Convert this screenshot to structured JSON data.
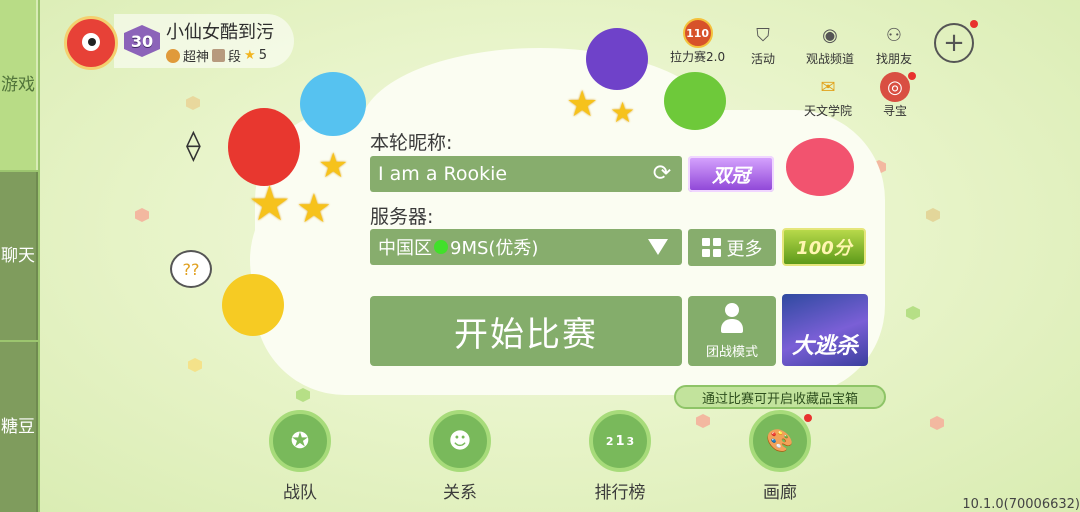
{
  "side_tabs": [
    {
      "label": "游戏",
      "active": true
    },
    {
      "label": "聊天",
      "active": false
    },
    {
      "label": "糖豆",
      "active": false
    }
  ],
  "player": {
    "level": "30",
    "name": "小仙女酷到污",
    "rank_title": "超神",
    "rank_suffix": "段",
    "rank_stars": "5"
  },
  "top_icons": [
    {
      "icon": "rally-110-badge",
      "badge_text": "110",
      "label": "拉力赛2.0"
    },
    {
      "icon": "activity-shield-icon",
      "label": "活动"
    },
    {
      "icon": "eye-icon",
      "label": "观战频道"
    },
    {
      "icon": "add-friend-icon",
      "label": "找朋友"
    },
    {
      "icon": "plus-icon",
      "label": "+"
    }
  ],
  "side_icons": [
    {
      "icon": "academy-icon",
      "label": "天文学院"
    },
    {
      "icon": "treasure-icon",
      "label": "寻宝"
    }
  ],
  "form": {
    "nickname_label": "本轮昵称:",
    "nickname_value": "I am a Rookie",
    "server_label": "服务器:",
    "server_region": "中国区",
    "server_latency": "9MS(优秀)",
    "more_label": "更多",
    "crown_badge": "双冠",
    "score_badge": "100分"
  },
  "actions": {
    "start_label": "开始比赛",
    "team_mode_label": "团战模式",
    "escape_label": "大逃杀",
    "tooltip": "通过比赛可开启收藏品宝箱"
  },
  "bottom_nav": [
    {
      "icon": "team-crest-icon",
      "label": "战队"
    },
    {
      "icon": "people-icon",
      "label": "关系"
    },
    {
      "icon": "podium-icon",
      "label": "排行榜",
      "podium": [
        "2",
        "1",
        "3"
      ]
    },
    {
      "icon": "palette-icon",
      "label": "画廊"
    }
  ],
  "version": "10.1.0(70006632)",
  "colors": {
    "accent_green": "#84ad6b",
    "side_tab": "#7f9c5d",
    "background": "#e6f3c6"
  }
}
